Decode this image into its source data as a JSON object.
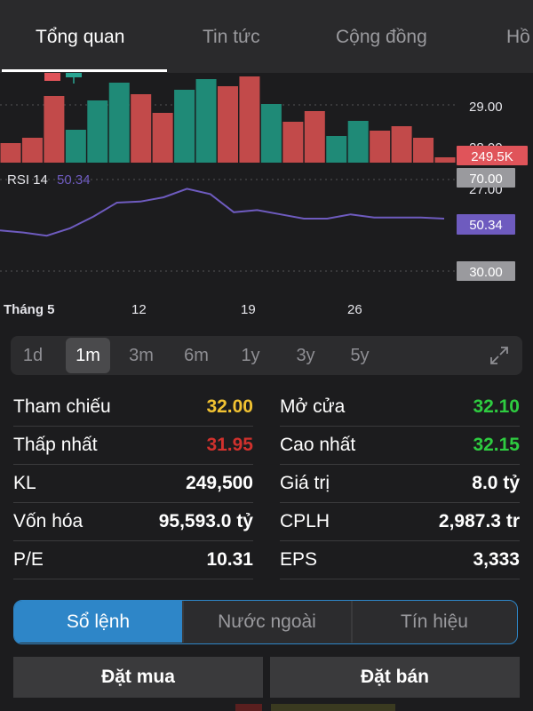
{
  "tabs": [
    {
      "label": "Tổng quan",
      "active": true
    },
    {
      "label": "Tin tức",
      "active": false
    },
    {
      "label": "Cộng đồng",
      "active": false
    },
    {
      "label": "Hồ",
      "active": false
    }
  ],
  "chart": {
    "price_axis": {
      "tick_29": "29.00",
      "tick_28": "28.00",
      "tick_27": "27.00"
    },
    "volume_badge": "249.5K",
    "rsi_label": "RSI 14",
    "rsi_value": "50.34",
    "rsi_levels": {
      "upper": "70.00",
      "lower": "30.00"
    },
    "x_labels": [
      "Tháng 5",
      "12",
      "19",
      "26"
    ],
    "colors": {
      "up": "#1f8a77",
      "down": "#c24a4a",
      "rsi_line": "#6e5bbf",
      "badge_red": "#e0545a",
      "badge_purple": "#6e5bbf",
      "badge_gray": "#9a9a9e"
    }
  },
  "chart_data": {
    "type": "bar",
    "volume_bars": [
      {
        "dir": "down",
        "value": 0.22
      },
      {
        "dir": "down",
        "value": 0.28
      },
      {
        "dir": "down",
        "value": 0.75
      },
      {
        "dir": "up",
        "value": 0.37
      },
      {
        "dir": "up",
        "value": 0.7
      },
      {
        "dir": "up",
        "value": 0.9
      },
      {
        "dir": "down",
        "value": 0.77
      },
      {
        "dir": "down",
        "value": 0.56
      },
      {
        "dir": "up",
        "value": 0.82
      },
      {
        "dir": "up",
        "value": 0.94
      },
      {
        "dir": "down",
        "value": 0.86
      },
      {
        "dir": "down",
        "value": 0.97
      },
      {
        "dir": "up",
        "value": 0.66
      },
      {
        "dir": "down",
        "value": 0.46
      },
      {
        "dir": "down",
        "value": 0.58
      },
      {
        "dir": "up",
        "value": 0.3
      },
      {
        "dir": "up",
        "value": 0.47
      },
      {
        "dir": "down",
        "value": 0.36
      },
      {
        "dir": "down",
        "value": 0.41
      },
      {
        "dir": "down",
        "value": 0.28
      },
      {
        "dir": "down",
        "value": 0.06
      }
    ],
    "rsi": [
      44,
      42,
      39,
      46,
      57,
      70,
      71,
      75,
      83,
      78,
      61,
      63,
      59,
      55,
      55,
      59,
      56,
      56,
      56,
      55
    ],
    "rsi_range": [
      0,
      100
    ]
  },
  "ranges": [
    "1d",
    "1m",
    "3m",
    "6m",
    "1y",
    "3y",
    "5y"
  ],
  "active_range": "1m",
  "stats": {
    "left": [
      {
        "label": "Tham chiếu",
        "value": "32.00",
        "color": "#f1c232"
      },
      {
        "label": "Thấp nhất",
        "value": "31.95",
        "color": "#d0312d"
      },
      {
        "label": "KL",
        "value": "249,500",
        "color": "#ffffff"
      },
      {
        "label": "Vốn hóa",
        "value": "95,593.0 tỷ",
        "color": "#ffffff"
      },
      {
        "label": "P/E",
        "value": "10.31",
        "color": "#ffffff"
      }
    ],
    "right": [
      {
        "label": "Mở cửa",
        "value": "32.10",
        "color": "#2ecc40"
      },
      {
        "label": "Cao nhất",
        "value": "32.15",
        "color": "#2ecc40"
      },
      {
        "label": "Giá trị",
        "value": "8.0 tỷ",
        "color": "#ffffff"
      },
      {
        "label": "CPLH",
        "value": "2,987.3 tr",
        "color": "#ffffff"
      },
      {
        "label": "EPS",
        "value": "3,333",
        "color": "#ffffff"
      }
    ]
  },
  "segment": [
    "Sổ lệnh",
    "Nước ngoài",
    "Tín hiệu"
  ],
  "buttons": {
    "buy": "Đặt mua",
    "sell": "Đặt bán"
  }
}
